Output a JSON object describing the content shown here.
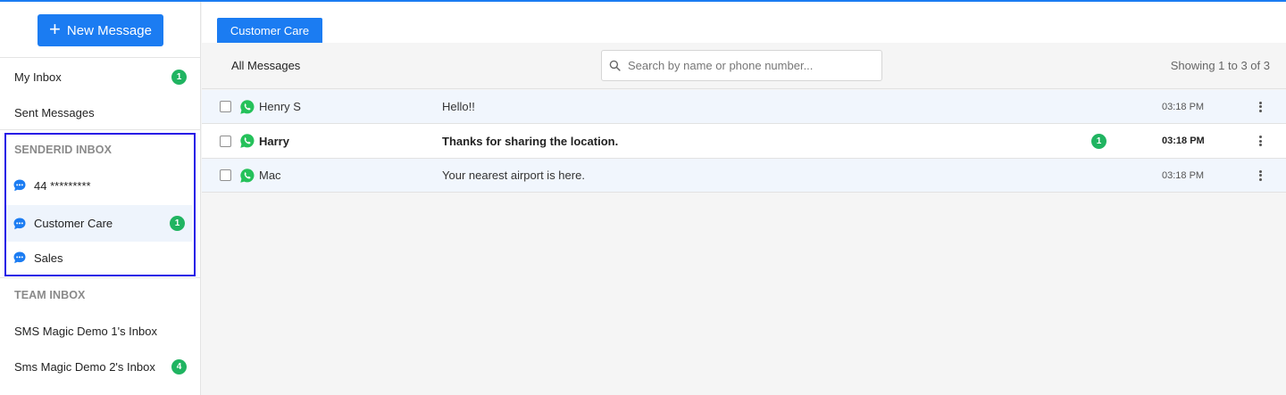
{
  "sidebar": {
    "new_message_label": "New Message",
    "my_inbox": {
      "label": "My Inbox",
      "count": "1"
    },
    "sent_messages": {
      "label": "Sent Messages"
    },
    "senderid_title": "SENDERID INBOX",
    "senderid_items": [
      {
        "label": "44 *********",
        "count": ""
      },
      {
        "label": "Customer Care",
        "count": "1"
      },
      {
        "label": "Sales",
        "count": ""
      }
    ],
    "team_title": "TEAM INBOX",
    "team_items": [
      {
        "label": "SMS Magic Demo 1's Inbox",
        "count": ""
      },
      {
        "label": "Sms Magic Demo 2's Inbox",
        "count": "4"
      }
    ]
  },
  "main": {
    "tab_label": "Customer Care",
    "filter_label": "All Messages",
    "search_placeholder": "Search by name or phone number...",
    "showing_text": "Showing 1 to 3 of 3",
    "rows": [
      {
        "name": "Henry S",
        "message": "Hello!!",
        "time": "03:18 PM",
        "unread": ""
      },
      {
        "name": "Harry",
        "message": "Thanks for sharing the location.",
        "time": "03:18 PM",
        "unread": "1"
      },
      {
        "name": "Mac",
        "message": "Your nearest airport is here.",
        "time": "03:18 PM",
        "unread": ""
      }
    ]
  },
  "colors": {
    "accent": "#1b7cf2",
    "badge": "#20b461",
    "highlight_box": "#2713e6",
    "whatsapp": "#25c15a"
  },
  "icons": {
    "sender_item": "chat-bubble-icon",
    "row_channel": "whatsapp-icon",
    "row_menu": "kebab-menu-icon",
    "search": "search-icon",
    "new_message": "plus-icon"
  }
}
